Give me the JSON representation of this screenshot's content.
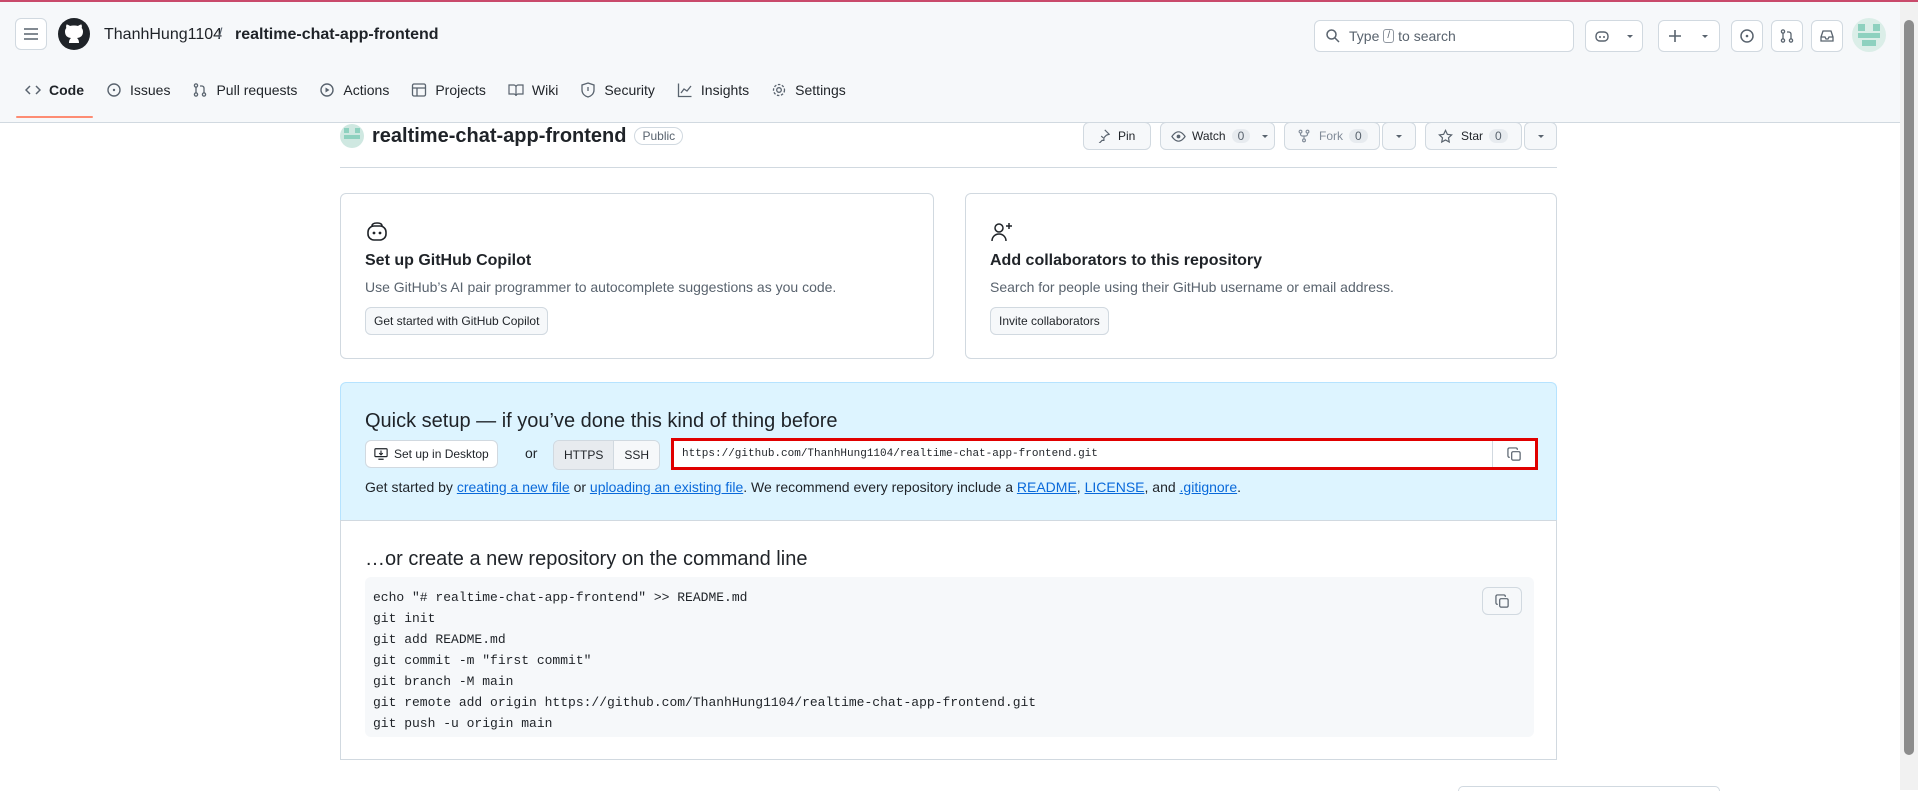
{
  "header": {
    "owner": "ThanhHung1104",
    "separator": "/",
    "repo": "realtime-chat-app-frontend",
    "search_prefix": "Type",
    "search_key": "/",
    "search_suffix": "to search"
  },
  "tabs": [
    {
      "label": "Code"
    },
    {
      "label": "Issues"
    },
    {
      "label": "Pull requests"
    },
    {
      "label": "Actions"
    },
    {
      "label": "Projects"
    },
    {
      "label": "Wiki"
    },
    {
      "label": "Security"
    },
    {
      "label": "Insights"
    },
    {
      "label": "Settings"
    }
  ],
  "repo": {
    "name": "realtime-chat-app-frontend",
    "visibility": "Public",
    "pin_label": "Pin",
    "watch_label": "Watch",
    "watch_count": "0",
    "fork_label": "Fork",
    "fork_count": "0",
    "star_label": "Star",
    "star_count": "0"
  },
  "cards": {
    "copilot": {
      "title": "Set up GitHub Copilot",
      "desc": "Use GitHub’s AI pair programmer to autocomplete suggestions as you code.",
      "button": "Get started with GitHub Copilot"
    },
    "collab": {
      "title": "Add collaborators to this repository",
      "desc": "Search for people using their GitHub username or email address.",
      "button": "Invite collaborators"
    }
  },
  "quick_setup": {
    "title": "Quick setup — if you’ve done this kind of thing before",
    "desktop_button": "Set up in Desktop",
    "or": "or",
    "https": "HTTPS",
    "ssh": "SSH",
    "url": "https://github.com/ThanhHung1104/realtime-chat-app-frontend.git",
    "note_1": "Get started by",
    "link_new_file": "creating a new file",
    "note_2": "or",
    "link_upload": "uploading an existing file",
    "note_3": ". We recommend every repository include a",
    "link_readme": "README",
    "comma": ",",
    "link_license": "LICENSE",
    "note_4": ", and",
    "link_gitignore": ".gitignore",
    "period": "."
  },
  "command_line": {
    "title": "…or create a new repository on the command line",
    "code": "echo \"# realtime-chat-app-frontend\" >> README.md\ngit init\ngit add README.md\ngit commit -m \"first commit\"\ngit branch -M main\ngit remote add origin https://github.com/ThanhHung1104/realtime-chat-app-frontend.git\ngit push -u origin main"
  },
  "colors": {
    "accent_underline": "#fd8c73",
    "link": "#0969da",
    "quick_setup_bg": "#ddf4ff",
    "highlight_border": "#e00000"
  }
}
